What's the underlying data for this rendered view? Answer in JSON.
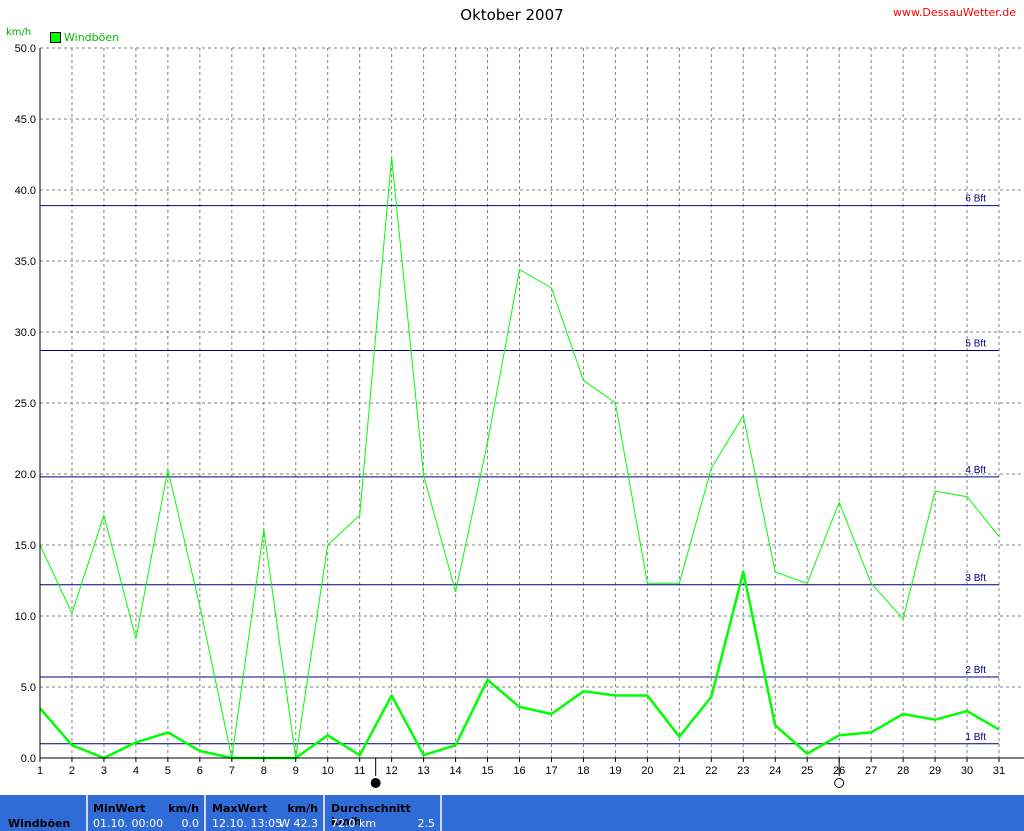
{
  "header": {
    "title": "Oktober 2007",
    "site": "www.DessauWetter.de",
    "unit": "km/h",
    "legend": "Windböen"
  },
  "colors": {
    "series": "#00ff00",
    "beaufort_lines": "#000080",
    "grid": "#808080",
    "footer_bg": "#2f6cd8"
  },
  "chart_data": {
    "type": "line",
    "title": "Oktober 2007",
    "ylabel": "km/h",
    "ylim": [
      0,
      50
    ],
    "xlim": [
      1,
      31
    ],
    "yticks": [
      "0.0",
      "5.0",
      "10.0",
      "15.0",
      "20.0",
      "25.0",
      "30.0",
      "35.0",
      "40.0",
      "45.0",
      "50.0"
    ],
    "xticks": [
      "1",
      "2",
      "3",
      "4",
      "5",
      "6",
      "7",
      "8",
      "9",
      "10",
      "11",
      "12",
      "13",
      "14",
      "15",
      "16",
      "17",
      "18",
      "19",
      "20",
      "21",
      "22",
      "23",
      "24",
      "25",
      "26",
      "27",
      "28",
      "29",
      "30",
      "31"
    ],
    "grid": true,
    "series": [
      {
        "name": "Windböen",
        "style": "max",
        "x": [
          1,
          2,
          3,
          4,
          5,
          6,
          7,
          8,
          9,
          10,
          11,
          12,
          13,
          14,
          15,
          16,
          17,
          18,
          19,
          20,
          21,
          22,
          23,
          24,
          25,
          26,
          27,
          28,
          29,
          30,
          31
        ],
        "values": [
          15.0,
          10.2,
          17.1,
          8.4,
          20.3,
          10.7,
          0.0,
          16.1,
          0.0,
          15.0,
          17.1,
          42.3,
          19.9,
          11.7,
          22.2,
          34.4,
          33.1,
          26.6,
          25.0,
          12.3,
          12.3,
          20.4,
          24.1,
          13.1,
          12.3,
          18.0,
          12.3,
          9.8,
          18.8,
          18.4,
          15.6
        ]
      },
      {
        "name": "Windböen",
        "style": "avg",
        "x": [
          1,
          2,
          3,
          4,
          5,
          6,
          7,
          8,
          9,
          10,
          11,
          12,
          13,
          14,
          15,
          16,
          17,
          18,
          19,
          20,
          21,
          22,
          23,
          24,
          25,
          26,
          27,
          28,
          29,
          30,
          31
        ],
        "values": [
          3.5,
          0.9,
          0.0,
          1.1,
          1.8,
          0.5,
          0.0,
          0.0,
          0.0,
          1.6,
          0.2,
          4.4,
          0.2,
          0.9,
          5.5,
          3.6,
          3.1,
          4.7,
          4.4,
          4.4,
          1.5,
          4.3,
          13.1,
          2.3,
          0.3,
          1.6,
          1.8,
          3.1,
          2.7,
          3.3,
          2.0
        ]
      }
    ],
    "reference_lines": [
      {
        "label": "1 Bft",
        "value": 1.0
      },
      {
        "label": "2 Bft",
        "value": 5.7
      },
      {
        "label": "3 Bft",
        "value": 12.2
      },
      {
        "label": "4 Bft",
        "value": 19.8
      },
      {
        "label": "5 Bft",
        "value": 28.7
      },
      {
        "label": "6 Bft",
        "value": 38.9
      }
    ],
    "moon_markers": [
      {
        "day": 11.5,
        "phase": "new"
      },
      {
        "day": 26.0,
        "phase": "full"
      }
    ]
  },
  "footer": {
    "label": "Windböen",
    "min": {
      "header": "MinWert",
      "unit": "km/h",
      "when": "01.10.  00:00",
      "value": "0.0"
    },
    "max": {
      "header": "MaxWert",
      "unit": "km/h",
      "when": "12.10.  13:05",
      "value": "W 42.3"
    },
    "avg": {
      "header": "Durchschnitt km/h",
      "distance": "72.0 km",
      "value": "2.5"
    }
  }
}
